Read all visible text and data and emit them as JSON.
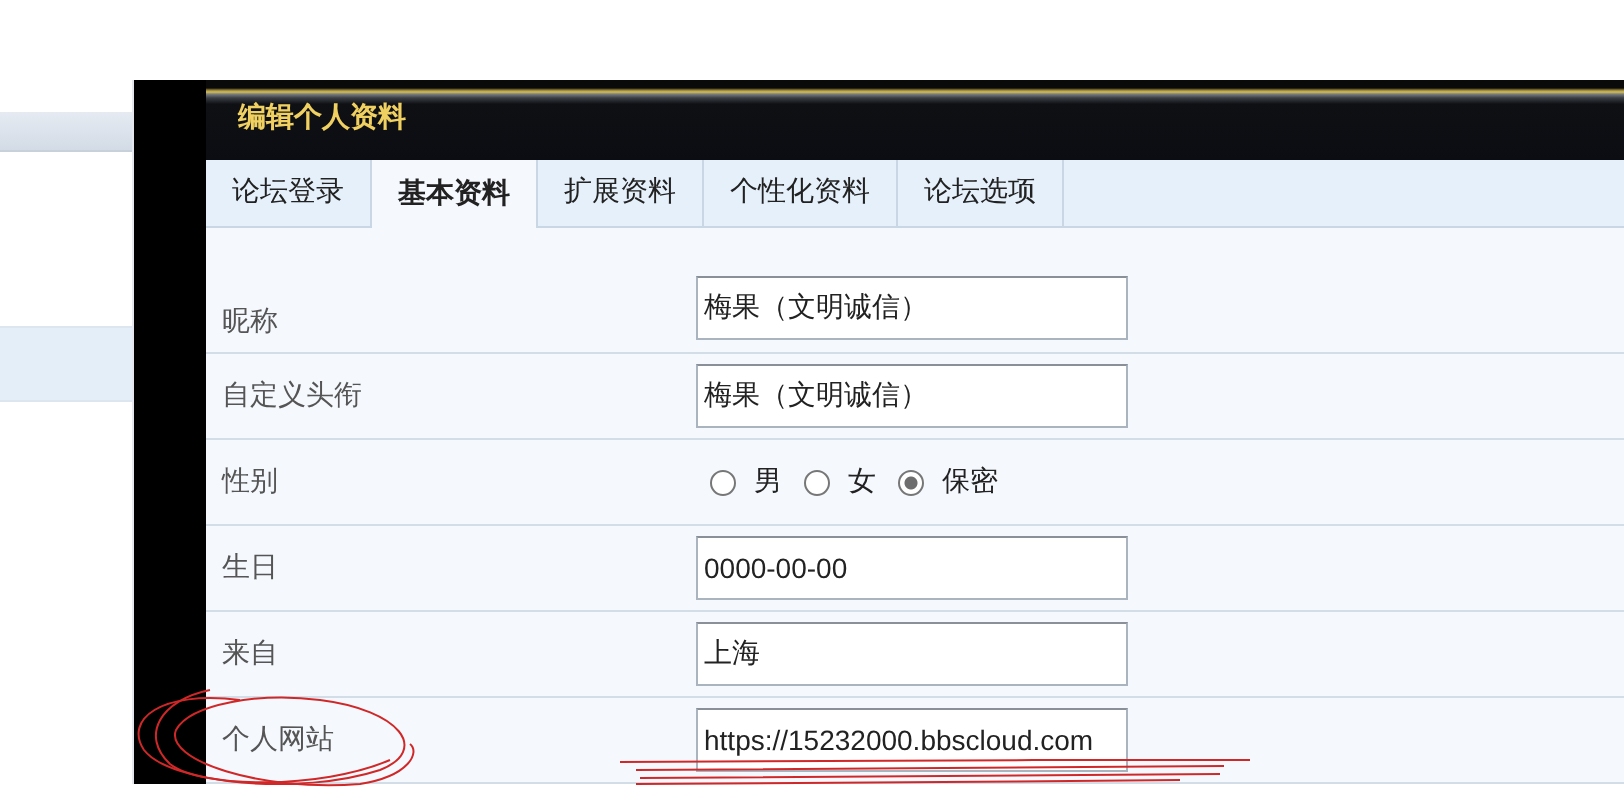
{
  "panel": {
    "title": "编辑个人资料"
  },
  "tabs": [
    {
      "label": "论坛登录",
      "selected": false
    },
    {
      "label": "基本资料",
      "selected": true
    },
    {
      "label": "扩展资料",
      "selected": false
    },
    {
      "label": "个性化资料",
      "selected": false
    },
    {
      "label": "论坛选项",
      "selected": false
    }
  ],
  "fields": [
    {
      "kind": "text",
      "label": "昵称",
      "value": "梅果（文明诚信）"
    },
    {
      "kind": "text",
      "label": "自定义头衔",
      "value": "梅果（文明诚信）"
    },
    {
      "kind": "radio",
      "label": "性别",
      "options": [
        {
          "label": "男",
          "selected": false
        },
        {
          "label": "女",
          "selected": false
        },
        {
          "label": "保密",
          "selected": true
        }
      ]
    },
    {
      "kind": "text",
      "label": "生日",
      "value": "0000-00-00"
    },
    {
      "kind": "text",
      "label": "来自",
      "value": "上海"
    },
    {
      "kind": "text",
      "label": "个人网站",
      "value": "https://15232000.bbscloud.com"
    }
  ]
}
